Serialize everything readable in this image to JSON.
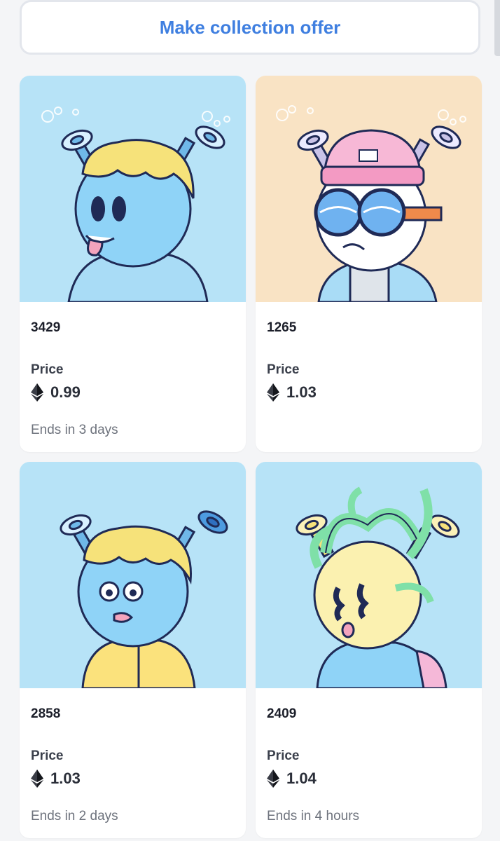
{
  "actions": {
    "collection_offer_label": "Make collection offer"
  },
  "cards": [
    {
      "token_id": "3429",
      "price_label": "Price",
      "price": "0.99",
      "ends": "Ends in 3 days",
      "bg": "#b7e3f7"
    },
    {
      "token_id": "1265",
      "price_label": "Price",
      "price": "1.03",
      "ends": "",
      "bg": "#f9e3c4"
    },
    {
      "token_id": "2858",
      "price_label": "Price",
      "price": "1.03",
      "ends": "Ends in 2 days",
      "bg": "#b7e3f7"
    },
    {
      "token_id": "2409",
      "price_label": "Price",
      "price": "1.04",
      "ends": "Ends in 4 hours",
      "bg": "#b7e3f7"
    }
  ],
  "colors": {
    "accent": "#3f7fe0",
    "muted": "#6e737d"
  }
}
